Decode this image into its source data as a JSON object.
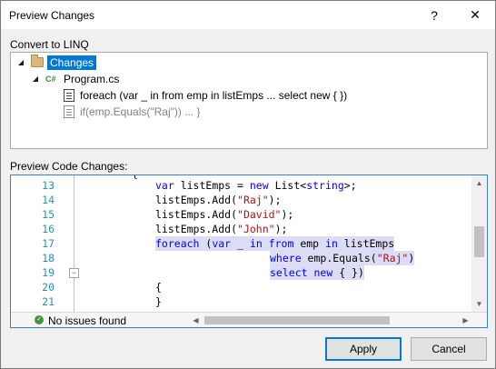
{
  "window": {
    "title": "Preview Changes",
    "help_glyph": "?",
    "close_glyph": "✕"
  },
  "convert_label": "Convert to LINQ",
  "tree": {
    "root": {
      "label": "Changes",
      "icon": "folder-icon",
      "expander": "◢"
    },
    "file": {
      "label": "Program.cs",
      "icon": "csharp-file-icon",
      "icon_text": "C#",
      "expander": "◢"
    },
    "items": [
      {
        "label": "foreach (var _ in from emp in listEmps ... select new { })",
        "icon": "code-doc-icon",
        "dim": false
      },
      {
        "label": "if(emp.Equals(\"Raj\")) ... }",
        "icon": "code-doc-icon",
        "dim": true
      }
    ]
  },
  "preview_label": "Preview Code Changes:",
  "editor": {
    "line_numbers": [
      "13",
      "14",
      "15",
      "16",
      "17",
      "18",
      "19",
      "20",
      "21"
    ],
    "top_brace": "{",
    "fold_glyph": "−",
    "code": {
      "l13": {
        "kw1": "var",
        "t1": " listEmps = ",
        "kw2": "new",
        "t2": " List<",
        "kw3": "string",
        "t3": ">;"
      },
      "l14": {
        "t1": "listEmps.Add(",
        "s1": "\"Raj\"",
        "t2": ");"
      },
      "l15": {
        "t1": "listEmps.Add(",
        "s1": "\"David\"",
        "t2": ");"
      },
      "l16": {
        "t1": "listEmps.Add(",
        "s1": "\"John\"",
        "t2": ");"
      },
      "l17": {
        "kw1": "foreach",
        "t1": " (",
        "kw2": "var",
        "t2": " _ ",
        "kw3": "in",
        "t3": " ",
        "kw4": "from",
        "t4": " emp ",
        "kw5": "in",
        "t5": " listEmps"
      },
      "l18": {
        "kw1": "where",
        "t1": " emp.Equals(",
        "s1": "\"Raj\"",
        "t2": ")"
      },
      "l19": {
        "kw1": "select",
        "t1": " ",
        "kw2": "new",
        "t2": " { })"
      },
      "l20": {
        "t1": "{"
      },
      "l21": {
        "t1": "}"
      }
    },
    "status": "No issues found",
    "ok_glyph": "✓"
  },
  "buttons": {
    "apply": "Apply",
    "cancel": "Cancel"
  },
  "colors": {
    "accent": "#0078d7",
    "keyword": "#0000ff",
    "string": "#a31515",
    "line_number": "#2b91af",
    "highlight": "#dcdcf4"
  }
}
